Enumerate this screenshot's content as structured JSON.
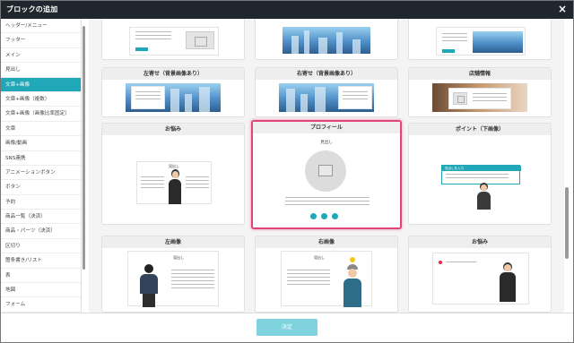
{
  "dialog": {
    "title": "ブロックの追加",
    "close_glyph": "×"
  },
  "sidebar": {
    "items": [
      "ヘッダー/メニュー",
      "フッター",
      "メイン",
      "見出し",
      "文章+画像",
      "文章+画像（複数）",
      "文章+画像（画像比率固定）",
      "文章",
      "画像/動画",
      "SNS連携",
      "アニメーションボタン",
      "ボタン",
      "予約",
      "商品一覧（決済）",
      "商品・パーツ（決済）",
      "区切り",
      "箇条書き/リスト",
      "表",
      "地図",
      "フォーム"
    ],
    "active_index": 4
  },
  "blocks": {
    "row2": [
      "左寄せ（背景画像あり）",
      "右寄せ（背景画像あり）",
      "店舗情報"
    ],
    "row3": [
      "お悩み",
      "プロフィール",
      "ポイント（下画像）"
    ],
    "row4": [
      "左画像",
      "右画像",
      "お悩み"
    ]
  },
  "previews": {
    "midashi": "見出し",
    "point_heading": "見出しを入力"
  },
  "footer": {
    "decide_label": "決定"
  },
  "colors": {
    "accent": "#21a8b8",
    "selected_border": "#e0447a",
    "titlebar": "#1f262d"
  }
}
